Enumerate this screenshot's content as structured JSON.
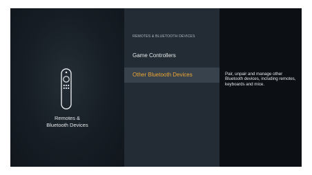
{
  "left_panel": {
    "icon": "remote-control-icon",
    "label_line1": "Remotes &",
    "label_line2": "Bluetooth Devices"
  },
  "menu": {
    "header": "REMOTES & BLUETOOTH DEVICES",
    "items": [
      {
        "label": "Game Controllers",
        "selected": false
      },
      {
        "label": "Other Bluetooth Devices",
        "selected": true
      }
    ]
  },
  "description": "Pair, unpair and manage other Bluetooth devices, including remotes, keyboards and mice.",
  "colors": {
    "accent": "#f0a733",
    "selected_row": "#37424c",
    "menu_background": "#232c34",
    "screen_background": "#0d1115"
  }
}
